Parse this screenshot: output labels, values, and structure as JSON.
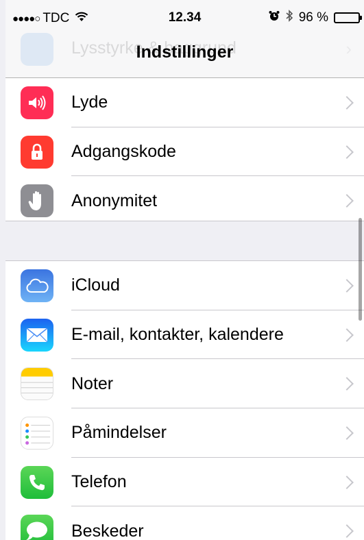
{
  "status_bar": {
    "signal": "●●●●○",
    "carrier": "TDC",
    "time": "12.34",
    "battery_text": "96 %",
    "battery_level": 0.96
  },
  "nav": {
    "title": "Indstillinger",
    "ghost_label": "Lysstyrke & baggrund"
  },
  "groups": [
    {
      "rows": [
        {
          "label": "Lyde",
          "icon": "speaker-icon",
          "color": "#ff2d55"
        },
        {
          "label": "Adgangskode",
          "icon": "lock-icon",
          "color": "#ff3b30"
        },
        {
          "label": "Anonymitet",
          "icon": "hand-icon",
          "color": "#8e8e93"
        }
      ]
    },
    {
      "rows": [
        {
          "label": "iCloud",
          "icon": "cloud-icon",
          "color": "#3f8cf0"
        },
        {
          "label": "E-mail, kontakter, kalendere",
          "icon": "mail-icon",
          "color": "#1a8cff"
        },
        {
          "label": "Noter",
          "icon": "notes-icon",
          "color": "#ffcc00"
        },
        {
          "label": "Påmindelser",
          "icon": "reminders-icon",
          "color": "#ffffff"
        },
        {
          "label": "Telefon",
          "icon": "phone-icon",
          "color": "#34c759"
        },
        {
          "label": "Beskeder",
          "icon": "messages-icon",
          "color": "#34c759"
        }
      ]
    }
  ]
}
